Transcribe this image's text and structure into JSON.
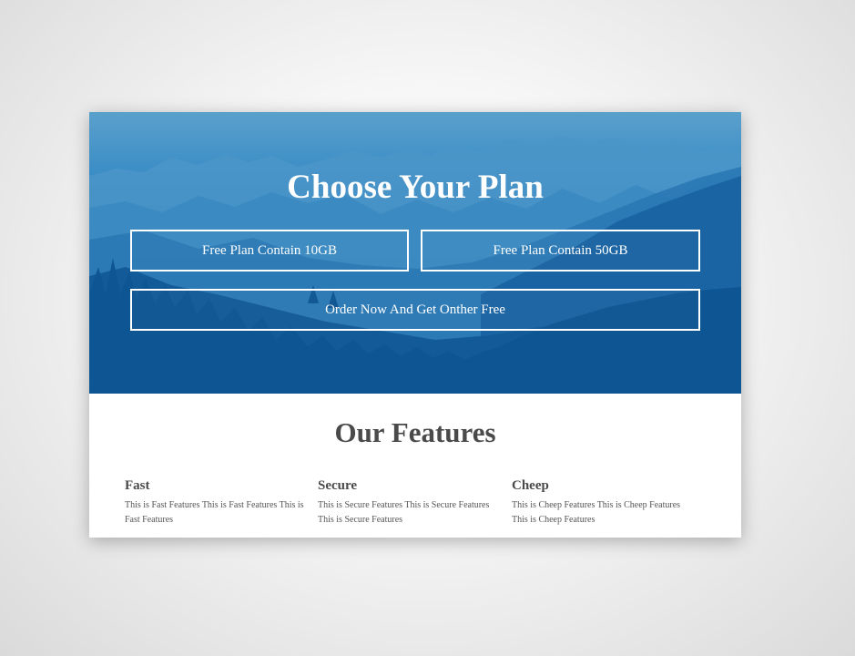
{
  "hero": {
    "title": "Choose Your Plan",
    "plans": [
      {
        "label": "Free Plan Contain 10GB"
      },
      {
        "label": "Free Plan Contain 50GB"
      }
    ],
    "order_label": "Order Now And Get Onther Free"
  },
  "features": {
    "title": "Our Features",
    "items": [
      {
        "name": "Fast",
        "description": "This is Fast Features This is Fast Features This is Fast Features"
      },
      {
        "name": "Secure",
        "description": "This is Secure Features This is Secure Features This is Secure Features"
      },
      {
        "name": "Cheep",
        "description": "This is Cheep Features This is Cheep Features This is Cheep Features"
      }
    ]
  },
  "colors": {
    "hero_blue": "#1f74b6",
    "text_dark": "#4a4a4a",
    "button_border": "#ffffff"
  }
}
